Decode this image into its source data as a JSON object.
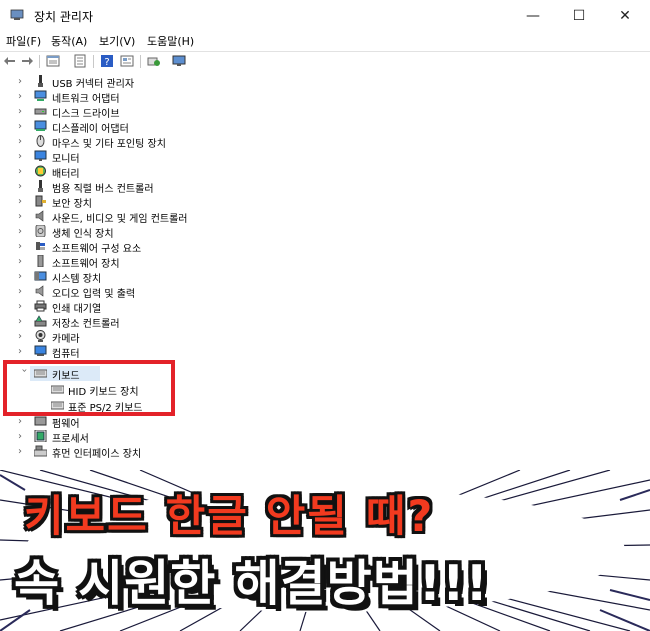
{
  "window": {
    "title": "장치 관리자",
    "controls": {
      "minimize": "—",
      "maximize": "☐",
      "close": "✕"
    }
  },
  "menu": [
    "파일(F)",
    "동작(A)",
    "보기(V)",
    "도움말(H)"
  ],
  "toolbar": [
    "back-icon",
    "forward-icon",
    "properties-icon",
    "list-icon",
    "help-icon",
    "details-icon",
    "scan-icon",
    "monitor-icon"
  ],
  "tree": {
    "items": [
      {
        "label": "USB 커넥터 관리자",
        "icon": "usb-icon"
      },
      {
        "label": "네트워크 어댑터",
        "icon": "network-adapter-icon"
      },
      {
        "label": "디스크 드라이브",
        "icon": "disk-drive-icon"
      },
      {
        "label": "디스플레이 어댑터",
        "icon": "display-adapter-icon"
      },
      {
        "label": "마우스 및 기타 포인팅 장치",
        "icon": "mouse-icon"
      },
      {
        "label": "모니터",
        "icon": "monitor-icon"
      },
      {
        "label": "배터리",
        "icon": "battery-icon"
      },
      {
        "label": "범용 직렬 버스 컨트롤러",
        "icon": "usb-controller-icon"
      },
      {
        "label": "보안 장치",
        "icon": "security-device-icon"
      },
      {
        "label": "사운드, 비디오 및 게임 컨트롤러",
        "icon": "sound-icon"
      },
      {
        "label": "생체 인식 장치",
        "icon": "biometric-icon"
      },
      {
        "label": "소프트웨어 구성 요소",
        "icon": "software-component-icon"
      },
      {
        "label": "소프트웨어 장치",
        "icon": "software-device-icon"
      },
      {
        "label": "시스템 장치",
        "icon": "system-device-icon"
      },
      {
        "label": "오디오 입력 및 출력",
        "icon": "audio-io-icon"
      },
      {
        "label": "인쇄 대기열",
        "icon": "printer-icon"
      },
      {
        "label": "저장소 컨트롤러",
        "icon": "storage-controller-icon"
      },
      {
        "label": "카메라",
        "icon": "camera-icon"
      },
      {
        "label": "컴퓨터",
        "icon": "computer-icon"
      }
    ],
    "keyboard": {
      "label": "키보드",
      "children": [
        "HID 키보드 장치",
        "표준 PS/2 키보드"
      ]
    },
    "after": [
      {
        "label": "펌웨어",
        "icon": "firmware-icon"
      },
      {
        "label": "프로세서",
        "icon": "processor-icon"
      },
      {
        "label": "휴먼 인터페이스 장치",
        "icon": "hid-icon"
      }
    ]
  },
  "banner": {
    "line1": "키보드 한글 안될 때?",
    "line2": "속 시원한 해결방법!!!",
    "colors": {
      "line1": "#f23a1f",
      "line2": "#ffffff",
      "highlight": "#e32229"
    }
  }
}
